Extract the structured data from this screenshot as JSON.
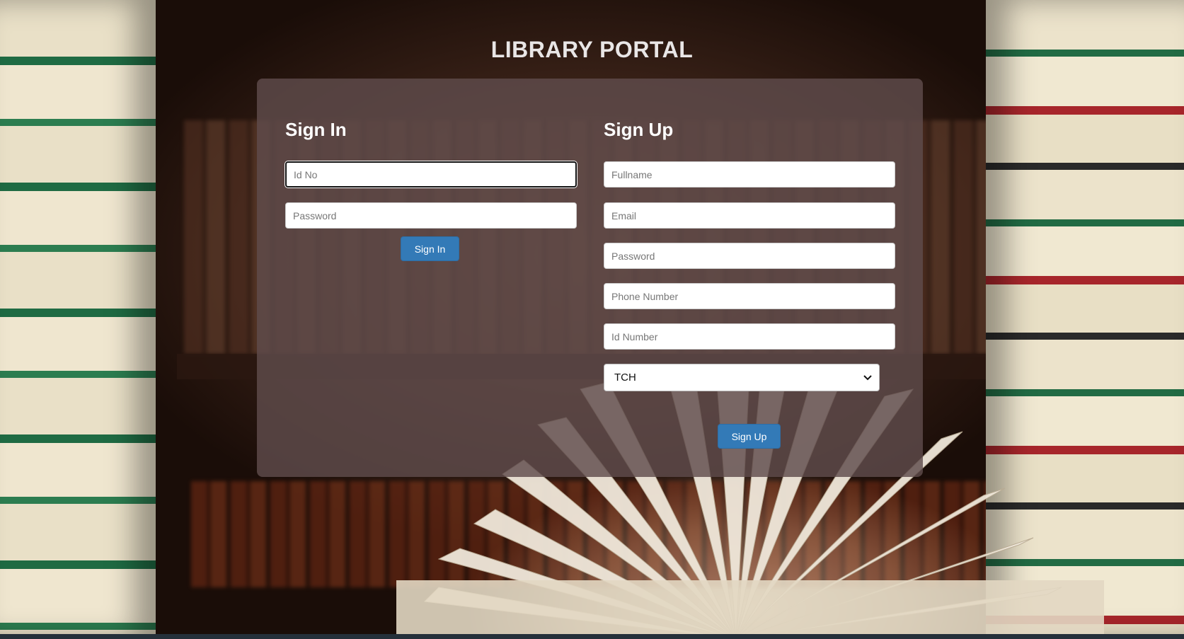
{
  "page": {
    "title": "LIBRARY PORTAL"
  },
  "signin": {
    "title": "Sign In",
    "id_placeholder": "Id No",
    "password_placeholder": "Password",
    "button_label": "Sign In"
  },
  "signup": {
    "title": "Sign Up",
    "fullname_placeholder": "Fullname",
    "email_placeholder": "Email",
    "password_placeholder": "Password",
    "phone_placeholder": "Phone Number",
    "idnumber_placeholder": "Id Number",
    "role_selected": "TCH",
    "button_label": "Sign Up"
  },
  "icons": {
    "select_arrow": "chevron-down-icon"
  },
  "colors": {
    "primary_button": "#337ab7",
    "panel": "#5f4c4c"
  }
}
